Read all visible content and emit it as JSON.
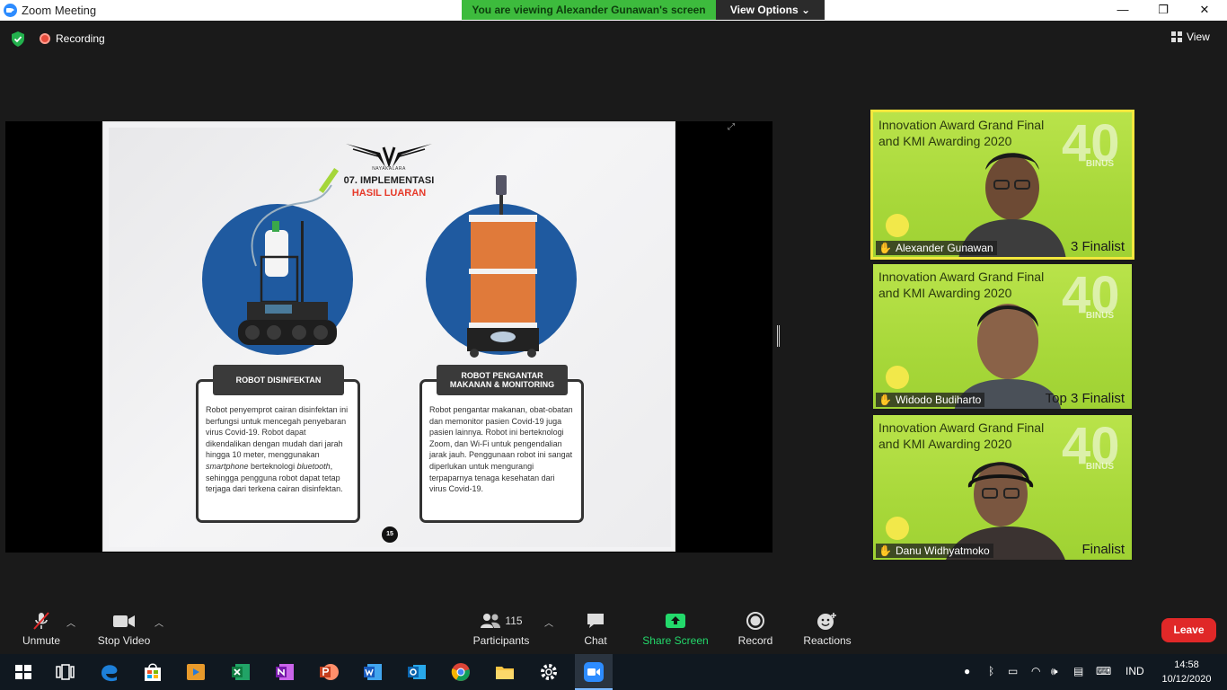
{
  "window": {
    "title": "Zoom Meeting",
    "banner": "You are viewing Alexander Gunawan's screen",
    "view_options": "View Options",
    "minimize": "—",
    "maximize": "❐",
    "close": "✕"
  },
  "top_strip": {
    "recording": "Recording",
    "view": "View"
  },
  "slide": {
    "logo_text": "NAYAKALARA",
    "heading_line1": "07. IMPLEMENTASI",
    "heading_line2": "HASIL LUARAN",
    "robot1_title": "ROBOT DISINFEKTAN",
    "robot1_desc_a": "Robot penyemprot cairan disinfektan ini berfungsi untuk mencegah penyebaran virus Covid-19. Robot dapat dikendalikan dengan mudah dari jarah hingga 10 meter, menggunakan ",
    "robot1_desc_em1": "smartphone",
    "robot1_desc_b": " berteknologi ",
    "robot1_desc_em2": "bluetooth",
    "robot1_desc_c": ", sehingga pengguna robot dapat tetap terjaga dari terkena cairan disinfektan.",
    "robot2_title": "ROBOT PENGANTAR MAKANAN & MONITORING",
    "robot2_desc": "Robot pengantar makanan, obat-obatan dan memonitor pasien Covid-19 juga pasien lainnya. Robot ini berteknologi Zoom, dan Wi-Fi untuk pengendalian jarak jauh. Penggunaan robot ini sangat diperlukan untuk mengurangi terpaparnya tenaga kesehatan dari virus Covid-19.",
    "page_number": "15"
  },
  "participants_videos": [
    {
      "name": "Alexander Gunawan",
      "title": "Innovation Award Grand Final and KMI Awarding 2020",
      "finalist": "3 Finalist"
    },
    {
      "name": "Widodo Budiharto",
      "title": "Innovation Award Grand Final and KMI Awarding 2020",
      "finalist": "Top 3 Finalist"
    },
    {
      "name": "Danu Widhyatmoko",
      "title": "Innovation Award Grand Final and KMI Awarding 2020",
      "finalist": "Finalist"
    }
  ],
  "tile_badge": {
    "big": "40",
    "small": "BINUS"
  },
  "toolbar": {
    "unmute": "Unmute",
    "stop_video": "Stop Video",
    "participants": "Participants",
    "participant_count": "115",
    "chat": "Chat",
    "share_screen": "Share Screen",
    "record": "Record",
    "reactions": "Reactions",
    "leave": "Leave"
  },
  "taskbar": {
    "language": "IND",
    "time": "14:58",
    "date": "10/12/2020"
  },
  "colors": {
    "zoom_blue": "#2d8cff",
    "banner_green": "#3dbb3d",
    "share_green": "#23d96b",
    "leave_red": "#e02828",
    "slide_blue": "#1f5aa0",
    "accent_red": "#e63a2a"
  }
}
